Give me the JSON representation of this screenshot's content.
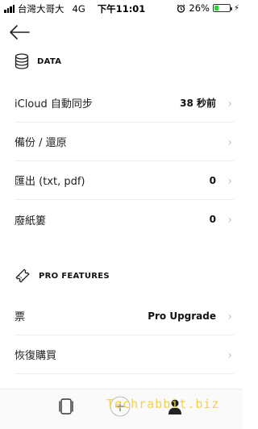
{
  "status_bar": {
    "carrier": "台灣大哥大",
    "network": "4G",
    "time": "下午11:01",
    "battery": "26%",
    "battery_level": 0.26
  },
  "sections": [
    {
      "title": "DATA",
      "icon": "database-icon",
      "rows": [
        {
          "label": "iCloud 自動同步",
          "value": "38 秒前"
        },
        {
          "label": "備份 / 還原",
          "value": ""
        },
        {
          "label": "匯出 (txt, pdf)",
          "value": "0"
        },
        {
          "label": "廢紙簍",
          "value": "0"
        }
      ]
    },
    {
      "title": "PRO FEATURES",
      "icon": "ticket-icon",
      "rows": [
        {
          "label": "票",
          "value": "Pro Upgrade"
        },
        {
          "label": "恢復購買",
          "value": ""
        }
      ]
    }
  ],
  "chevron": "›",
  "watermark": "Techrabbit.biz"
}
